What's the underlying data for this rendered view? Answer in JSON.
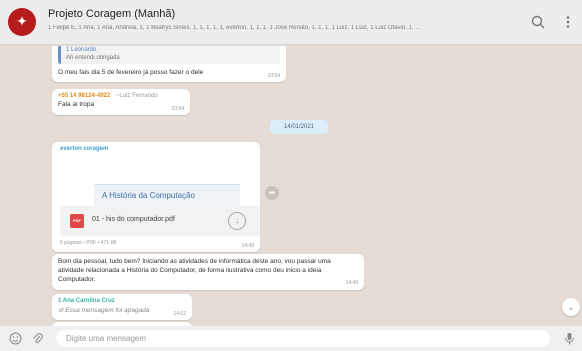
{
  "chat": {
    "title": "Projeto Coragem (Manhã)",
    "members": "1 Felipe E, 1 Ana, 1 Ana, Andreia, 1, 1 Beatrys Sineis, 1, 1, 1, 1, 1, everton, 1, 1, 1, 1 Jose Renato, 1, 1, 1, 1 Luiz, 1 Luiz, 1 Luiz Otavio, 1, ..."
  },
  "messages": {
    "m1": {
      "quote_author": "1 Leonardo",
      "quote_text": "Ah entendi obrigada",
      "text": "O meu fais dia 5 de fevereiro já posso fazer o dele",
      "time": "10:54"
    },
    "m2": {
      "phone": "+55 14 98124-4922",
      "name_hint": "~Luiz Fernando",
      "text": "Fala ai tropa",
      "time": "10:54"
    },
    "date_chip": "14/01/2021",
    "m3": {
      "sender": "everton coragem",
      "slide_title": "A História da Computação",
      "file_name": "01 - his do computador.pdf",
      "file_meta": "5 páginas • PDF • 471 kB",
      "file_time": "14:49",
      "pdf_label": "PDF"
    },
    "m4": {
      "text": "Bom dia pessoal, tudo bem? Iniciando as atividades de informática deste ano, vou passar uma atividade relacionada a História do Computador, de forma ilustrativa como deu inicio a ideia Computador.",
      "time": "14:49"
    },
    "m5": {
      "sender": "1 Ana Carolina Cruz",
      "text": "Essa mensagem foi apagada",
      "time": "14:52"
    }
  },
  "composer": {
    "placeholder": "Digite uma mensagem"
  },
  "icons": {
    "search": "search-icon",
    "menu": "kebab-menu-icon",
    "emoji": "emoji-icon",
    "attach": "paperclip-icon",
    "mic": "microphone-icon",
    "download": "download-icon",
    "share": "share-icon",
    "scroll": "chevron-down-icon"
  },
  "colors": {
    "header_bg": "#ededed",
    "chat_bg": "#e5ddd5",
    "phone_color": "#e08a1e",
    "sender_everton": "#3ea0c9",
    "sender_ana": "#35b3a3",
    "date_chip": "#dceefa"
  }
}
